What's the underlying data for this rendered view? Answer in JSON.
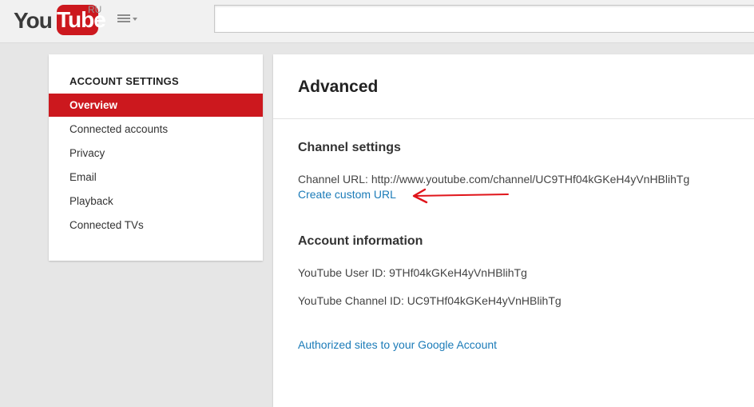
{
  "masthead": {
    "logo_you": "You",
    "logo_tube": "Tube",
    "logo_region": "RU",
    "search_value": ""
  },
  "sidebar": {
    "heading": "ACCOUNT SETTINGS",
    "items": [
      {
        "label": "Overview",
        "active": true
      },
      {
        "label": "Connected accounts"
      },
      {
        "label": "Privacy"
      },
      {
        "label": "Email"
      },
      {
        "label": "Playback"
      },
      {
        "label": "Connected TVs"
      }
    ]
  },
  "main": {
    "title": "Advanced",
    "channel_settings": {
      "heading": "Channel settings",
      "channel_url": "Channel URL: http://www.youtube.com/channel/UC9THf04kGKeH4yVnHBlihTg",
      "custom_url_link": "Create custom URL"
    },
    "account_info": {
      "heading": "Account information",
      "user_id": "YouTube User ID: 9THf04kGKeH4yVnHBlihTg",
      "channel_id": "YouTube Channel ID: UC9THf04kGKeH4yVnHBlihTg"
    },
    "authorized_sites_link": "Authorized sites to your Google Account"
  },
  "colors": {
    "brand_red": "#cc181e",
    "link_blue": "#1b7bb8",
    "annotation_red": "#e0151b"
  }
}
